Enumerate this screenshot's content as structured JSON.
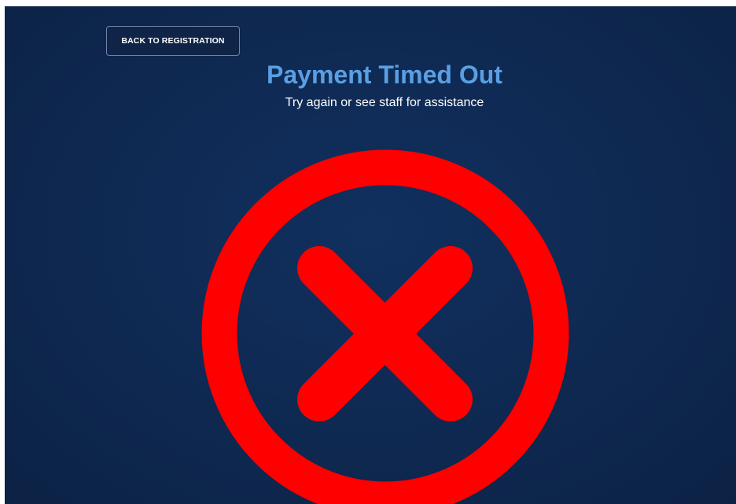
{
  "nav": {
    "back_label": "BACK TO REGISTRATION"
  },
  "status": {
    "title": "Payment Timed Out",
    "subtitle": "Try again or see staff for assistance",
    "icon": "error-x-circle-icon"
  },
  "colors": {
    "background": "#0f2a53",
    "title": "#5a9fe3",
    "error_red": "#ff0000"
  }
}
